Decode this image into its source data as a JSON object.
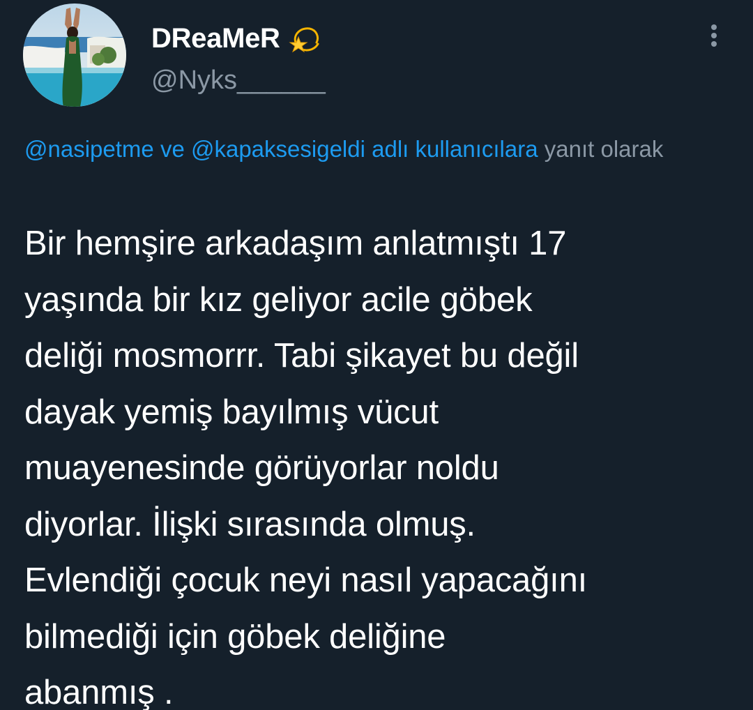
{
  "author": {
    "display_name": "DReaMeR",
    "handle": "@Nyks______",
    "name_emoji": "dizzy-star-icon",
    "avatar": "avatar-photo"
  },
  "reply_context": {
    "mention_1": "@nasipetme",
    "connector": "ve",
    "mention_2": "@kapaksesigeldi",
    "suffix_link": "adlı kullanıcılara",
    "suffix_text": "yanıt olarak"
  },
  "tweet": {
    "text": "Bir hemşire arkadaşım anlatmıştı 17\nyaşında bir kız geliyor acile göbek\ndeliği mosmorrr. Tabi şikayet bu değil\ndayak yemiş bayılmış vücut\nmuayenesinde görüyorlar noldu\ndiyorlar. İlişki sırasında olmuş.\nEvlendiği çocuk neyi nasıl yapacağını\nbilmediği için göbek deliğine\nabanmış ."
  },
  "menu": {
    "more_icon": "more-vertical-icon"
  },
  "colors": {
    "background": "#15202b",
    "text_primary": "#ffffff",
    "text_secondary": "#8b98a5",
    "link": "#1d9bf0"
  }
}
